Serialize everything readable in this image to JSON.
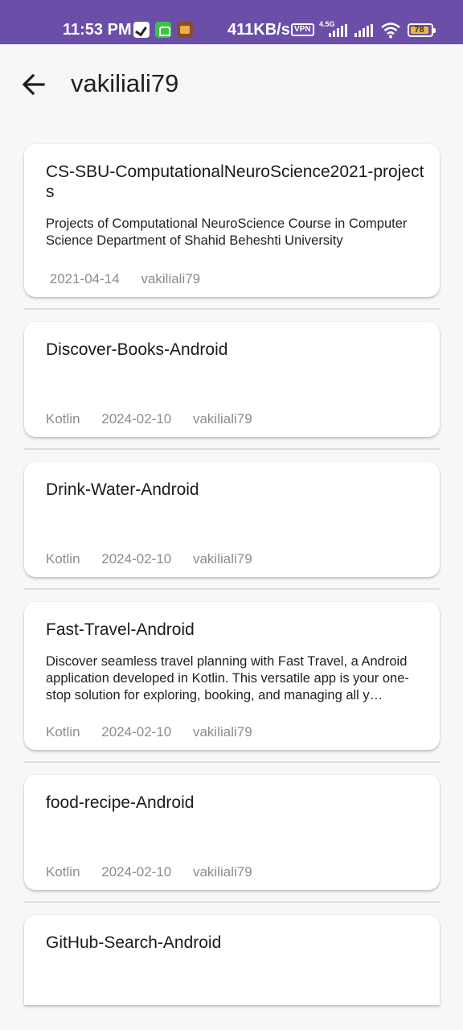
{
  "status_bar": {
    "time": "11:53 PM",
    "speed": "411KB/s",
    "vpn": "VPN",
    "network": "4.5G",
    "battery": "78",
    "battery_color": "#f2b53b",
    "icons": [
      "v-app-icon",
      "android-icon",
      "game-icon",
      "signal-icon",
      "wifi-icon",
      "battery-icon"
    ]
  },
  "header": {
    "title": "vakiliali79",
    "back_icon": "back-arrow-icon"
  },
  "colors": {
    "status_bar": "#6a4ea8",
    "background": "#f7f7f7",
    "card": "#ffffff",
    "meta_text": "#8c8c8c"
  },
  "repos": [
    {
      "name": "CS-SBU-ComputationalNeuroScience2021-projects",
      "description": "Projects of Computational NeuroScience Course in Computer Science Department of Shahid Beheshti University",
      "language": "",
      "date": "2021-04-14",
      "owner": "vakiliali79"
    },
    {
      "name": "Discover-Books-Android",
      "description": "",
      "language": "Kotlin",
      "date": "2024-02-10",
      "owner": "vakiliali79"
    },
    {
      "name": "Drink-Water-Android",
      "description": "",
      "language": "Kotlin",
      "date": "2024-02-10",
      "owner": "vakiliali79"
    },
    {
      "name": "Fast-Travel-Android",
      "description": "Discover seamless travel planning with Fast Travel, a Android application developed in Kotlin. This versatile app is your one-stop solution for exploring, booking, and managing all y…",
      "language": "Kotlin",
      "date": "2024-02-10",
      "owner": "vakiliali79"
    },
    {
      "name": "food-recipe-Android",
      "description": "",
      "language": "Kotlin",
      "date": "2024-02-10",
      "owner": "vakiliali79"
    },
    {
      "name": "GitHub-Search-Android",
      "description": "",
      "language": "",
      "date": "",
      "owner": ""
    }
  ]
}
